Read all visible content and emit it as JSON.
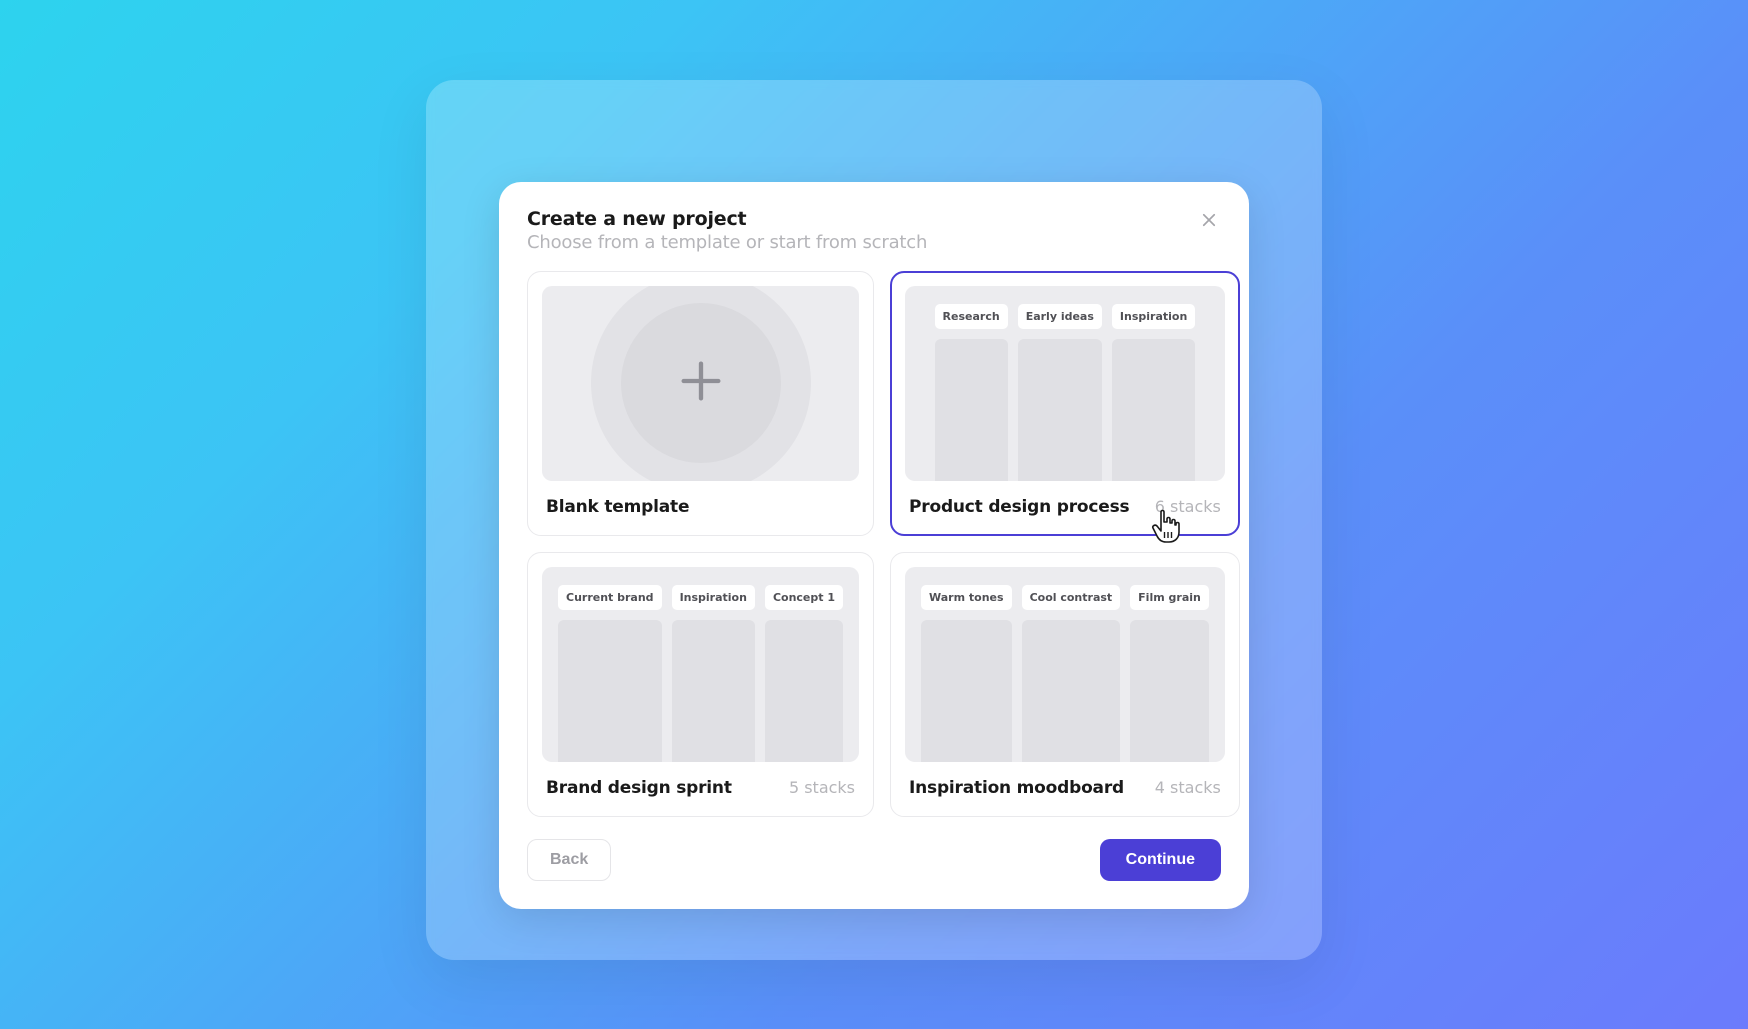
{
  "modal": {
    "title": "Create a new project",
    "subtitle": "Choose from a template or start from scratch"
  },
  "templates": [
    {
      "title": "Blank template",
      "meta": "",
      "kind": "blank",
      "selected": false,
      "stacks": []
    },
    {
      "title": "Product design process",
      "meta": "6 stacks",
      "kind": "stacks",
      "selected": true,
      "stacks": [
        "Research",
        "Early ideas",
        "Inspiration"
      ]
    },
    {
      "title": "Brand design sprint",
      "meta": "5 stacks",
      "kind": "stacks",
      "selected": false,
      "stacks": [
        "Current brand",
        "Inspiration",
        "Concept 1"
      ]
    },
    {
      "title": "Inspiration moodboard",
      "meta": "4 stacks",
      "kind": "stacks",
      "selected": false,
      "stacks": [
        "Warm tones",
        "Cool contrast",
        "Film grain"
      ]
    }
  ],
  "actions": {
    "back": "Back",
    "continue": "Continue"
  }
}
